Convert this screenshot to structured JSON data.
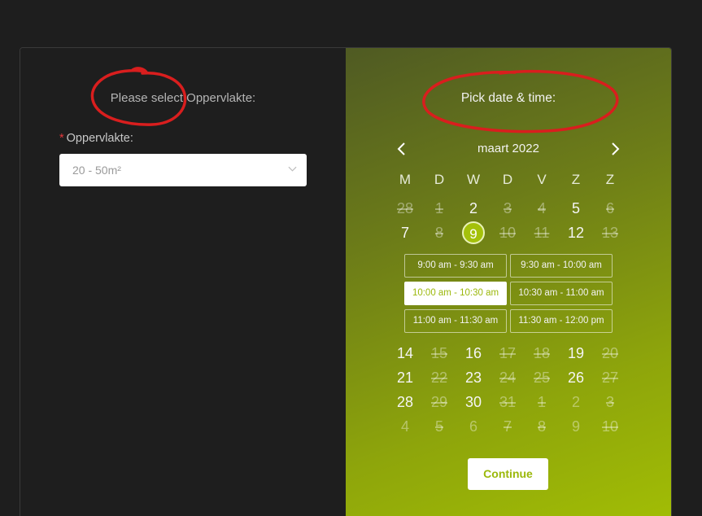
{
  "left_panel": {
    "title": "Please select Oppervlakte:",
    "field_label": "Oppervlakte:",
    "required_mark": "*",
    "select_value": "20 - 50m²"
  },
  "right_panel": {
    "title": "Pick date & time:",
    "month_label": "maart 2022",
    "weekdays": [
      "M",
      "D",
      "W",
      "D",
      "V",
      "Z",
      "Z"
    ],
    "weeks_top": [
      [
        {
          "d": "28",
          "s": "dis"
        },
        {
          "d": "1",
          "s": "dis"
        },
        {
          "d": "2",
          "s": "on"
        },
        {
          "d": "3",
          "s": "dis"
        },
        {
          "d": "4",
          "s": "dis"
        },
        {
          "d": "5",
          "s": "on"
        },
        {
          "d": "6",
          "s": "dis"
        }
      ],
      [
        {
          "d": "7",
          "s": "on"
        },
        {
          "d": "8",
          "s": "dis"
        },
        {
          "d": "9",
          "s": "sel"
        },
        {
          "d": "10",
          "s": "dis"
        },
        {
          "d": "11",
          "s": "dis"
        },
        {
          "d": "12",
          "s": "on"
        },
        {
          "d": "13",
          "s": "dis"
        }
      ]
    ],
    "time_slots": [
      {
        "label": "9:00 am - 9:30 am",
        "active": false
      },
      {
        "label": "9:30 am - 10:00 am",
        "active": false
      },
      {
        "label": "10:00 am - 10:30 am",
        "active": true
      },
      {
        "label": "10:30 am - 11:00 am",
        "active": false
      },
      {
        "label": "11:00 am - 11:30 am",
        "active": false
      },
      {
        "label": "11:30 am - 12:00 pm",
        "active": false
      }
    ],
    "weeks_bottom": [
      [
        {
          "d": "14",
          "s": "on"
        },
        {
          "d": "15",
          "s": "dis"
        },
        {
          "d": "16",
          "s": "on"
        },
        {
          "d": "17",
          "s": "dis"
        },
        {
          "d": "18",
          "s": "dis"
        },
        {
          "d": "19",
          "s": "on"
        },
        {
          "d": "20",
          "s": "dis"
        }
      ],
      [
        {
          "d": "21",
          "s": "on"
        },
        {
          "d": "22",
          "s": "dis"
        },
        {
          "d": "23",
          "s": "on"
        },
        {
          "d": "24",
          "s": "dis"
        },
        {
          "d": "25",
          "s": "dis"
        },
        {
          "d": "26",
          "s": "on"
        },
        {
          "d": "27",
          "s": "dis"
        }
      ],
      [
        {
          "d": "28",
          "s": "on"
        },
        {
          "d": "29",
          "s": "dis"
        },
        {
          "d": "30",
          "s": "on"
        },
        {
          "d": "31",
          "s": "dis"
        },
        {
          "d": "1",
          "s": "dis"
        },
        {
          "d": "2",
          "s": "dim"
        },
        {
          "d": "3",
          "s": "dis"
        }
      ],
      [
        {
          "d": "4",
          "s": "dim"
        },
        {
          "d": "5",
          "s": "dis"
        },
        {
          "d": "6",
          "s": "dim"
        },
        {
          "d": "7",
          "s": "dis"
        },
        {
          "d": "8",
          "s": "dis"
        },
        {
          "d": "9",
          "s": "dim"
        },
        {
          "d": "10",
          "s": "dis"
        }
      ]
    ],
    "continue_label": "Continue"
  },
  "icons": {
    "prev": "chevron-left-icon",
    "next": "chevron-right-icon",
    "select": "chevron-down-icon"
  },
  "colors": {
    "accent": "#9bb80b",
    "annotation": "#d91e1e"
  }
}
